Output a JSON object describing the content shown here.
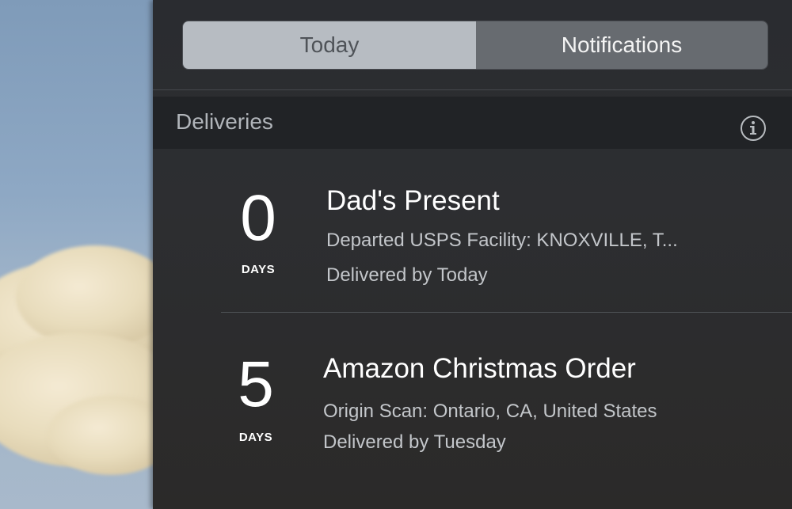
{
  "tabs": {
    "today_label": "Today",
    "notifications_label": "Notifications",
    "selected": "Notifications"
  },
  "section": {
    "title": "Deliveries",
    "info_icon": "info-icon"
  },
  "deliveries": [
    {
      "count": "0",
      "unit": "DAYS",
      "title": "Dad's Present",
      "status": "Departed USPS Facility: KNOXVILLE, T...",
      "eta": "Delivered by Today"
    },
    {
      "count": "5",
      "unit": "DAYS",
      "title": "Amazon Christmas Order",
      "status": "Origin Scan: Ontario, CA, United States",
      "eta": "Delivered by Tuesday"
    }
  ]
}
